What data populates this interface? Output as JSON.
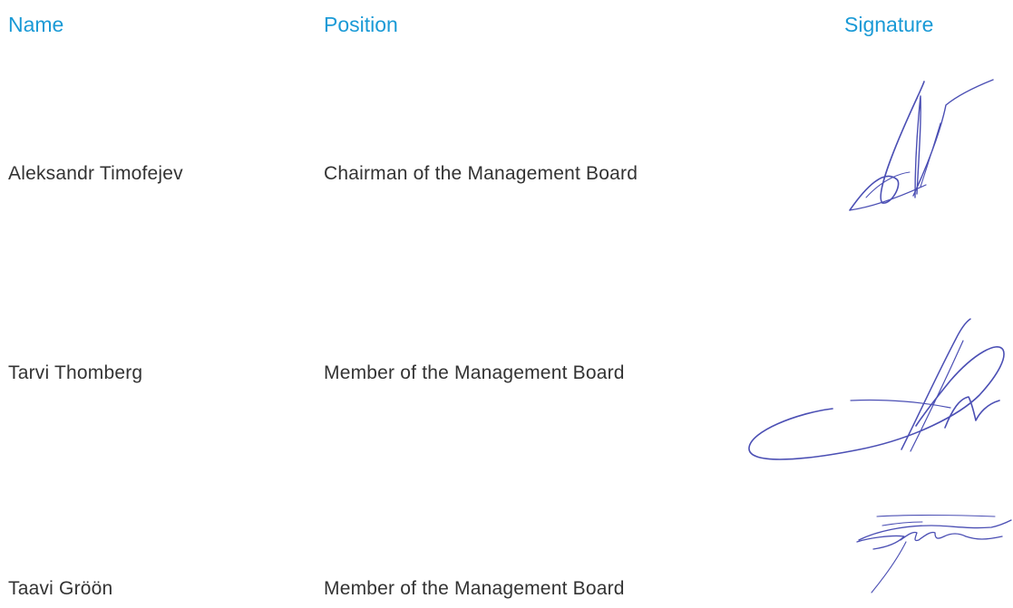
{
  "headers": {
    "name": "Name",
    "position": "Position",
    "signature": "Signature"
  },
  "rows": [
    {
      "name": "Aleksandr Timofejev",
      "position": "Chairman of the Management Board",
      "signature_icon": "handwritten-signature"
    },
    {
      "name": "Tarvi Thomberg",
      "position": "Member of the Management Board",
      "signature_icon": "handwritten-signature"
    },
    {
      "name": "Taavi Gröön",
      "position": "Member of the Management Board",
      "signature_icon": "handwritten-signature"
    }
  ],
  "colors": {
    "header": "#1a9ad6",
    "text": "#333333",
    "signature_ink": "#4b4fb4"
  }
}
